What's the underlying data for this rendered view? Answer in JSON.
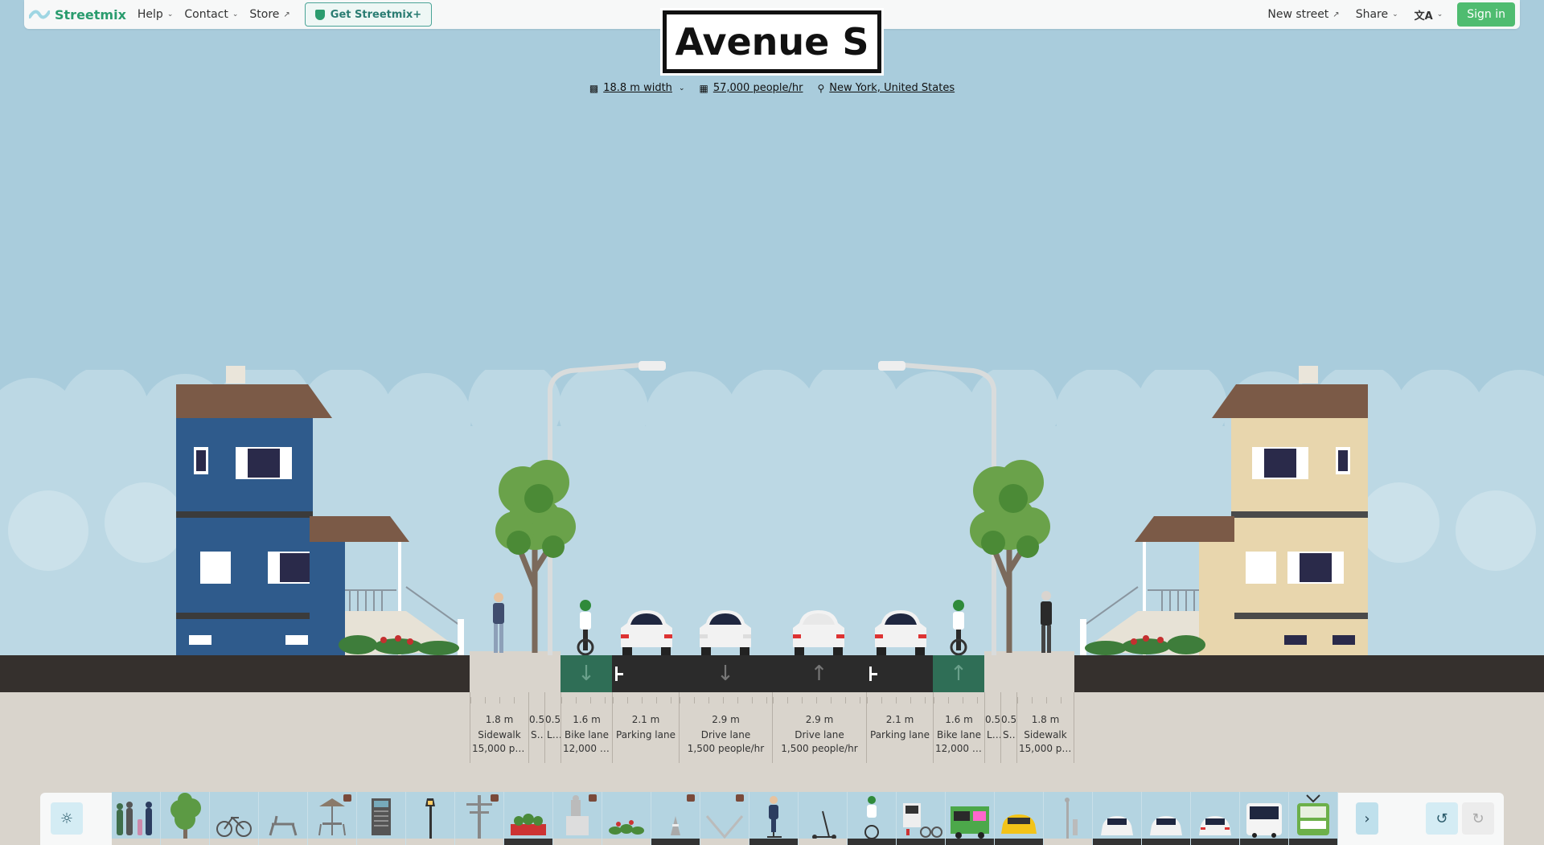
{
  "app": {
    "brand": "Streetmix",
    "nav": [
      {
        "label": "Help",
        "kind": "dropdown"
      },
      {
        "label": "Contact",
        "kind": "dropdown"
      },
      {
        "label": "Store",
        "kind": "external"
      }
    ],
    "plus_button": "Get Streetmix+",
    "right_nav": [
      {
        "label": "New street",
        "kind": "external"
      },
      {
        "label": "Share",
        "kind": "dropdown"
      }
    ],
    "signin": "Sign in"
  },
  "street": {
    "name": "Avenue S",
    "width": "18.8 m width",
    "capacity": "57,000 people/hr",
    "location": "New York, United States"
  },
  "segments": [
    {
      "width": "1.8 m",
      "name": "Sidewalk",
      "capacity": "15,000 pe..."
    },
    {
      "width": "0.5",
      "name": "S...",
      "capacity": ""
    },
    {
      "width": "0.5",
      "name": "L...",
      "capacity": ""
    },
    {
      "width": "1.6 m",
      "name": "Bike lane",
      "capacity": "12,000 p..."
    },
    {
      "width": "2.1 m",
      "name": "Parking lane",
      "capacity": ""
    },
    {
      "width": "2.9 m",
      "name": "Drive lane",
      "capacity": "1,500 people/hr"
    },
    {
      "width": "2.9 m",
      "name": "Drive lane",
      "capacity": "1,500 people/hr"
    },
    {
      "width": "2.1 m",
      "name": "Parking lane",
      "capacity": ""
    },
    {
      "width": "1.6 m",
      "name": "Bike lane",
      "capacity": "12,000 p..."
    },
    {
      "width": "0.5",
      "name": "L...",
      "capacity": ""
    },
    {
      "width": "0.5",
      "name": "S...",
      "capacity": ""
    },
    {
      "width": "1.8 m",
      "name": "Sidewalk",
      "capacity": "15,000 pe..."
    }
  ],
  "palette": {
    "items": [
      {
        "icon": "pedestrians-icon",
        "locked": false,
        "base": "light"
      },
      {
        "icon": "tree-icon",
        "locked": false,
        "base": "light"
      },
      {
        "icon": "bike-rack-icon",
        "locked": false,
        "base": "light"
      },
      {
        "icon": "bench-icon",
        "locked": false,
        "base": "light"
      },
      {
        "icon": "outdoor-dining-icon",
        "locked": true,
        "base": "light"
      },
      {
        "icon": "bike-share-station-icon",
        "locked": false,
        "base": "light"
      },
      {
        "icon": "lamp-post-icon",
        "locked": false,
        "base": "light"
      },
      {
        "icon": "utility-pole-icon",
        "locked": true,
        "base": "light"
      },
      {
        "icon": "parklet-icon",
        "locked": false,
        "base": "dark"
      },
      {
        "icon": "vendor-icon",
        "locked": true,
        "base": "light"
      },
      {
        "icon": "planter-icon",
        "locked": false,
        "base": "light"
      },
      {
        "icon": "traffic-cone-icon",
        "locked": true,
        "base": "dark"
      },
      {
        "icon": "swale-icon",
        "locked": true,
        "base": "light"
      },
      {
        "icon": "scooter-rider-icon",
        "locked": false,
        "base": "dark"
      },
      {
        "icon": "scooter-icon",
        "locked": false,
        "base": "light"
      },
      {
        "icon": "cyclist-icon",
        "locked": false,
        "base": "dark"
      },
      {
        "icon": "bike-share-icon",
        "locked": false,
        "base": "dark"
      },
      {
        "icon": "food-truck-icon",
        "locked": false,
        "base": "dark"
      },
      {
        "icon": "taxi-icon",
        "locked": false,
        "base": "dark"
      },
      {
        "icon": "transit-shelter-icon",
        "locked": false,
        "base": "light"
      },
      {
        "icon": "car-parking-icon",
        "locked": false,
        "base": "dark"
      },
      {
        "icon": "car-drive-icon",
        "locked": false,
        "base": "dark"
      },
      {
        "icon": "car-icon",
        "locked": false,
        "base": "dark"
      },
      {
        "icon": "bus-icon",
        "locked": false,
        "base": "dark"
      },
      {
        "icon": "streetcar-icon",
        "locked": false,
        "base": "dark"
      }
    ]
  },
  "colors": {
    "sky": "#a9ccdc",
    "brand": "#2a9c6e",
    "signin": "#4fbc70",
    "bike_lane": "#2f6e56",
    "road": "#2b2b2b",
    "sidewalk": "#d9d4cc"
  }
}
